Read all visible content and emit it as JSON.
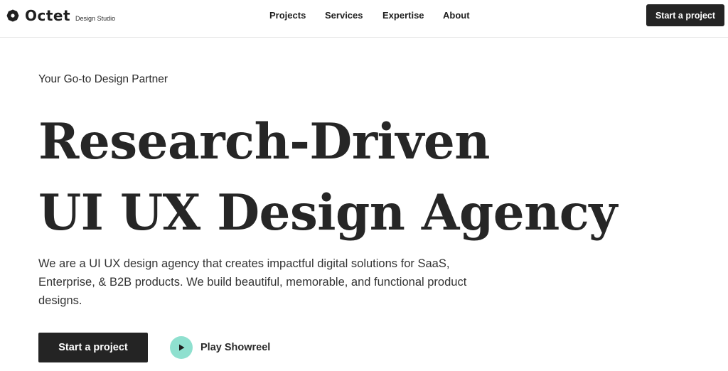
{
  "brand": {
    "name": "Octet",
    "tagline": "Design Studio",
    "logo_icon": "octet-logo-icon"
  },
  "nav": {
    "items": [
      {
        "label": "Projects"
      },
      {
        "label": "Services"
      },
      {
        "label": "Expertise"
      },
      {
        "label": "About"
      }
    ],
    "cta_label": "Start a project"
  },
  "hero": {
    "eyebrow": "Your Go-to Design Partner",
    "headline_line1": "Research-Driven",
    "headline_line2": "UI UX Design Agency",
    "description": "We are a UI UX design agency that creates impactful digital solutions for SaaS, Enterprise, & B2B products. We build beautiful, memorable, and functional product designs.",
    "primary_cta": "Start a project",
    "secondary_cta": "Play Showreel",
    "secondary_icon": "play-icon"
  },
  "colors": {
    "dark": "#242424",
    "accent_mint": "#8fe0cf",
    "text": "#262626"
  }
}
